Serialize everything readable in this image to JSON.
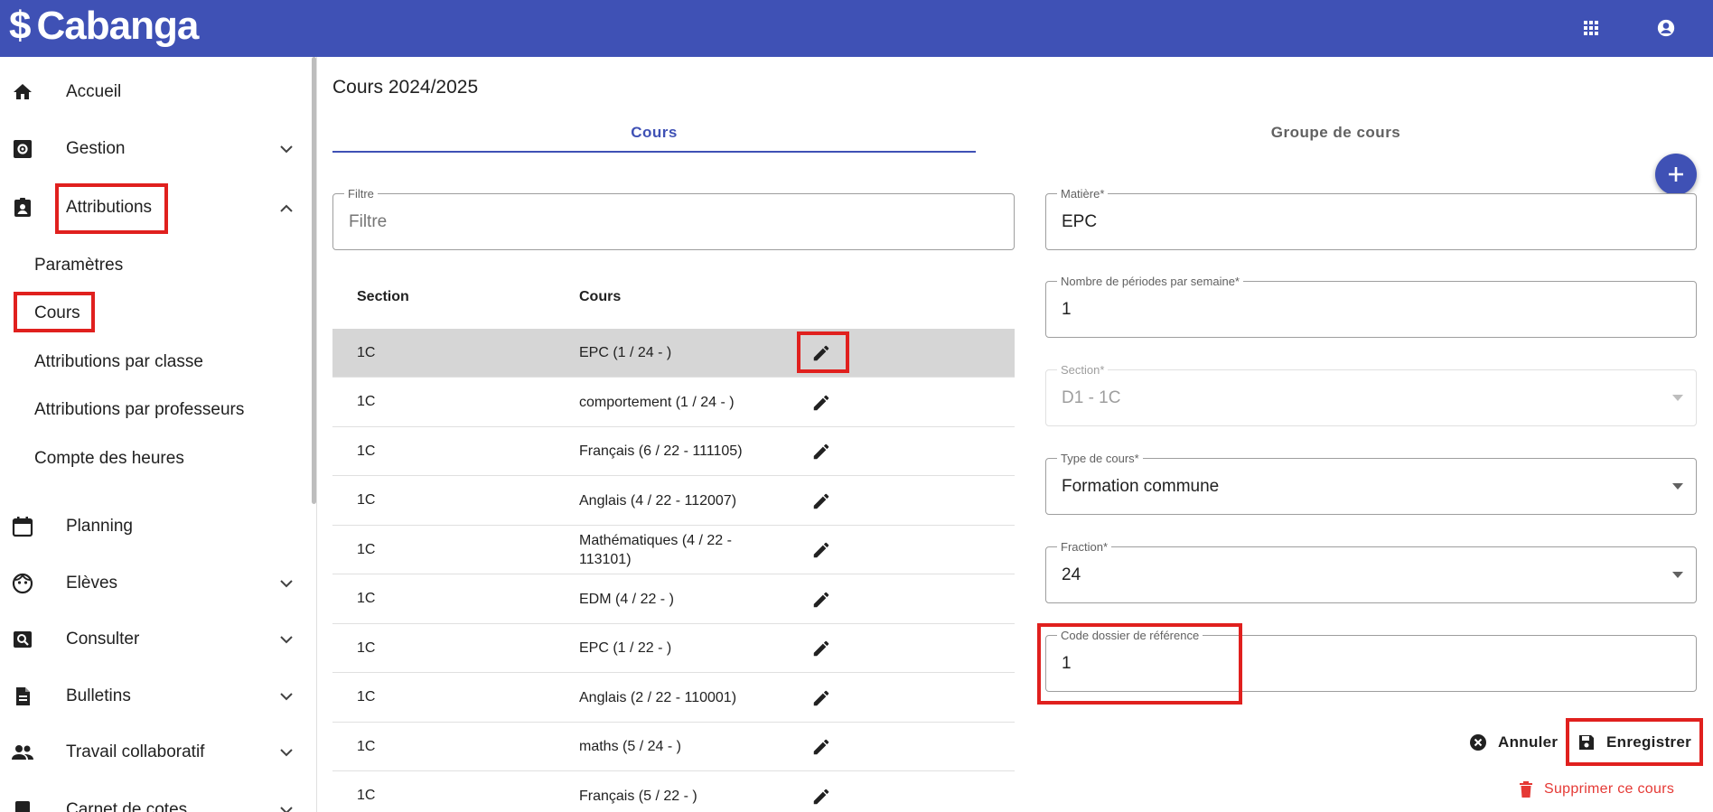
{
  "app": {
    "logo_symbol": "$",
    "logo_text": "Cabanga"
  },
  "header": {
    "apps_icon": "apps-icon",
    "account_icon": "account-circle-icon"
  },
  "colors": {
    "primary": "#3f51b5",
    "highlight": "#e0201e",
    "danger": "#e53935",
    "selected_row": "#d6d6d6"
  },
  "sidebar": {
    "items": [
      {
        "label": "Accueil",
        "icon": "home-icon"
      },
      {
        "label": "Gestion",
        "icon": "settings-box-icon"
      },
      {
        "label": "Attributions",
        "icon": "clipboard-account-icon"
      },
      {
        "label": "Planning",
        "icon": "calendar-icon"
      },
      {
        "label": "Elèves",
        "icon": "face-icon"
      },
      {
        "label": "Consulter",
        "icon": "search-box-icon"
      },
      {
        "label": "Bulletins",
        "icon": "file-document-icon"
      },
      {
        "label": "Travail collaboratif",
        "icon": "people-icon"
      },
      {
        "label": "Carnet de cotes",
        "icon": "notebook-icon"
      }
    ],
    "sub_items": [
      {
        "label": "Paramètres"
      },
      {
        "label": "Cours"
      },
      {
        "label": "Attributions par classe"
      },
      {
        "label": "Attributions par professeurs"
      },
      {
        "label": "Compte des heures"
      }
    ]
  },
  "page": {
    "title": "Cours 2024/2025"
  },
  "tabs": [
    {
      "label": "Cours",
      "active": true
    },
    {
      "label": "Groupe de cours",
      "active": false
    }
  ],
  "filter": {
    "legend": "Filtre",
    "placeholder": "Filtre",
    "value": ""
  },
  "table": {
    "headers": {
      "section": "Section",
      "cours": "Cours"
    },
    "rows": [
      {
        "section": "1C",
        "cours": "EPC (1 / 24 - )",
        "selected": true
      },
      {
        "section": "1C",
        "cours": "comportement (1 / 24 - )"
      },
      {
        "section": "1C",
        "cours": "Français (6 / 22 - 111105)"
      },
      {
        "section": "1C",
        "cours": "Anglais (4 / 22 - 112007)"
      },
      {
        "section": "1C",
        "cours": "Mathématiques (4 / 22 - 113101)"
      },
      {
        "section": "1C",
        "cours": "EDM (4 / 22 - )"
      },
      {
        "section": "1C",
        "cours": "EPC (1 / 22 - )"
      },
      {
        "section": "1C",
        "cours": "Anglais (2 / 22 - 110001)"
      },
      {
        "section": "1C",
        "cours": "maths (5 / 24 - )"
      },
      {
        "section": "1C",
        "cours": "Français (5 / 22 - )"
      }
    ]
  },
  "form": {
    "matiere": {
      "label": "Matière*",
      "value": "EPC"
    },
    "periodes": {
      "label": "Nombre de périodes par semaine*",
      "value": "1"
    },
    "section": {
      "label": "Section*",
      "value": "D1 - 1C"
    },
    "type_cours": {
      "label": "Type de cours*",
      "value": "Formation commune"
    },
    "fraction": {
      "label": "Fraction*",
      "value": "24"
    },
    "code_dossier": {
      "label": "Code dossier de référence",
      "value": "1"
    }
  },
  "actions": {
    "cancel": "Annuler",
    "save": "Enregistrer",
    "delete": "Supprimer ce cours"
  }
}
